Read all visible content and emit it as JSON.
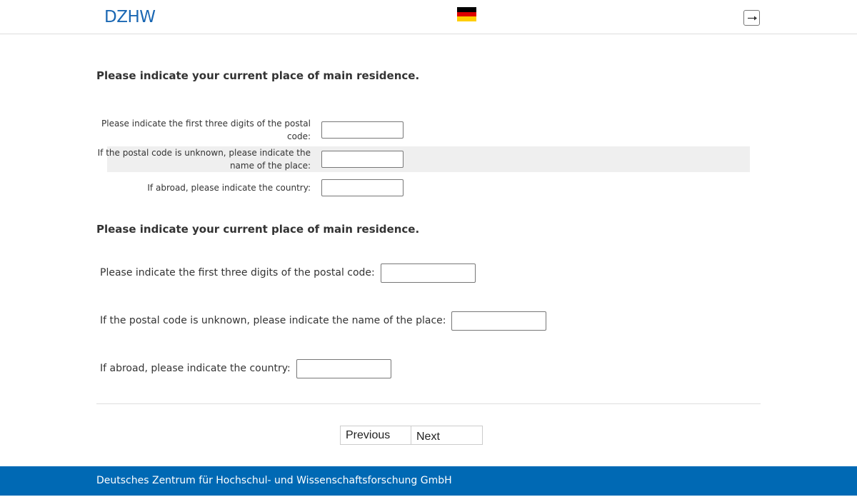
{
  "header": {
    "logo": "DZHW",
    "language_flag": "de-flag-icon",
    "logout_icon": "logout-icon"
  },
  "colors": {
    "brand_blue": "#0069b4",
    "logo_blue": "#1a67b3",
    "flag_black": "#000000",
    "flag_red": "#dd0000",
    "flag_gold": "#ffce00",
    "row_alt_bg": "#efefef"
  },
  "question1": {
    "title": "Please indicate your current place of main residence.",
    "rows": [
      {
        "label": "Please indicate the first three digits of the postal code:",
        "value": ""
      },
      {
        "label": "If the postal code is unknown, please indicate the name of the place:",
        "value": ""
      },
      {
        "label": "If abroad, please indicate the country:",
        "value": ""
      }
    ]
  },
  "question2": {
    "title": "Please indicate your current place of main residence.",
    "rows": [
      {
        "label": "Please indicate the first three digits of the postal code:",
        "value": ""
      },
      {
        "label": "If the postal code is unknown, please indicate the name of the place:",
        "value": ""
      },
      {
        "label": "If abroad, please indicate the country:",
        "value": ""
      }
    ]
  },
  "navigation": {
    "previous_label": "Previous",
    "next_label": "Next"
  },
  "footer": {
    "text": "Deutsches Zentrum für Hochschul- und Wissenschaftsforschung GmbH"
  }
}
